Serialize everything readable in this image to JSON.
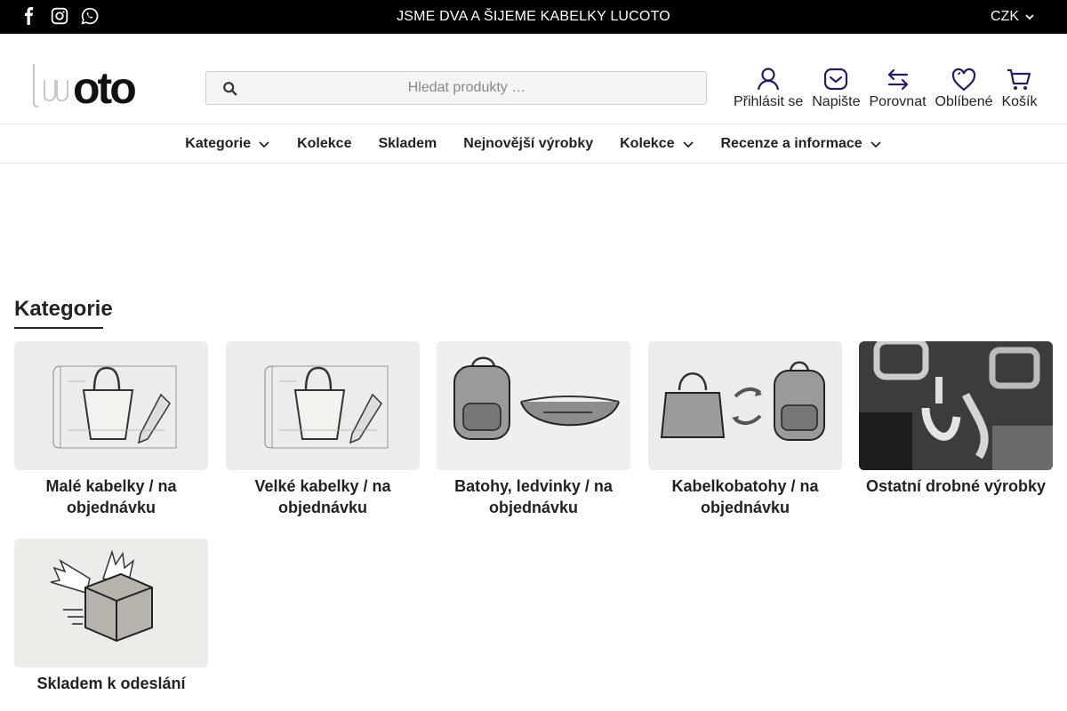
{
  "topbar": {
    "announcement": "JSME DVA A ŠIJEME KABELKY LUCOTO",
    "currency": "CZK",
    "social": [
      "facebook-icon",
      "instagram-icon",
      "whatsapp-icon"
    ]
  },
  "header": {
    "logo_text": "lucoto",
    "search_placeholder": "Hledat produkty …",
    "actions": [
      {
        "label": "Přihlásit se",
        "icon": "user-icon"
      },
      {
        "label": "Napište",
        "icon": "message-icon"
      },
      {
        "label": "Porovnat",
        "icon": "compare-icon"
      },
      {
        "label": "Oblíbené",
        "icon": "heart-icon"
      },
      {
        "label": "Košík",
        "icon": "cart-icon"
      }
    ]
  },
  "nav": {
    "items": [
      {
        "label": "Kategorie",
        "dropdown": true
      },
      {
        "label": "Kolekce",
        "dropdown": false
      },
      {
        "label": "Skladem",
        "dropdown": false
      },
      {
        "label": "Nejnovější výrobky",
        "dropdown": false
      },
      {
        "label": "Kolekce",
        "dropdown": true
      },
      {
        "label": "Recenze a informace",
        "dropdown": true
      }
    ]
  },
  "main": {
    "section_title": "Kategorie",
    "categories": [
      {
        "title": "Malé kabelky / na objednávku",
        "image": "handbag-blueprint-sketch"
      },
      {
        "title": "Velké kabelky / na objednávku",
        "image": "handbag-blueprint-sketch"
      },
      {
        "title": "Batohy, ledvinky / na objednávku",
        "image": "backpack-and-waist-bag-sketch"
      },
      {
        "title": "Kabelkobatohy / na objednávku",
        "image": "handbag-to-backpack-sketch"
      },
      {
        "title": "Ostatní drobné výrobky",
        "image": "metal-hardware-clasps-photo"
      },
      {
        "title": "Skladem k odeslání",
        "image": "flying-box-sketch"
      }
    ]
  },
  "colors": {
    "topbar_bg": "#000000",
    "text": "#222222",
    "icon_accent": "#2a1a5e"
  }
}
